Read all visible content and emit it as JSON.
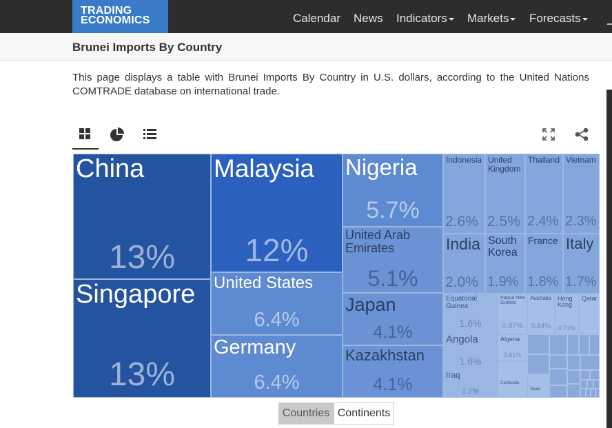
{
  "logo": {
    "line1": "TRADING",
    "line2": "ECONOMICS"
  },
  "nav": [
    {
      "label": "Calendar",
      "dropdown": false
    },
    {
      "label": "News",
      "dropdown": false
    },
    {
      "label": "Indicators",
      "dropdown": true
    },
    {
      "label": "Markets",
      "dropdown": true
    },
    {
      "label": "Forecasts",
      "dropdown": true
    }
  ],
  "page": {
    "title": "Brunei Imports By Country",
    "description": "This page displays a table with Brunei Imports By Country in U.S. dollars, according to the United Nations COMTRADE database on international trade."
  },
  "views": [
    "treemap-icon",
    "pie-chart-icon",
    "list-icon"
  ],
  "tools": [
    "fullscreen-icon",
    "share-icon"
  ],
  "treemap": [
    {
      "name": "China",
      "pct": "13%"
    },
    {
      "name": "Singapore",
      "pct": "13%"
    },
    {
      "name": "Malaysia",
      "pct": "12%"
    },
    {
      "name": "United States",
      "pct": "6.4%"
    },
    {
      "name": "Germany",
      "pct": "6.4%"
    },
    {
      "name": "Nigeria",
      "pct": "5.7%"
    },
    {
      "name": "United Arab Emirates",
      "pct": "5.1%"
    },
    {
      "name": "Japan",
      "pct": "4.1%"
    },
    {
      "name": "Kazakhstan",
      "pct": "4.1%"
    },
    {
      "name": "Indonesia",
      "pct": "2.6%"
    },
    {
      "name": "United Kingdom",
      "pct": "2.5%"
    },
    {
      "name": "Thailand",
      "pct": "2.4%"
    },
    {
      "name": "Vietnam",
      "pct": "2.3%"
    },
    {
      "name": "India",
      "pct": "2.0%"
    },
    {
      "name": "South Korea",
      "pct": "1.9%"
    },
    {
      "name": "France",
      "pct": "1.8%"
    },
    {
      "name": "Italy",
      "pct": "1.7%"
    },
    {
      "name": "Equatorial Guinea",
      "pct": "1.6%"
    },
    {
      "name": "Angola",
      "pct": "1.6%"
    },
    {
      "name": "Iraq",
      "pct": "1.2%"
    },
    {
      "name": "Papua New Guinea",
      "pct": "0.97%"
    },
    {
      "name": "Australia",
      "pct": "0.84%"
    },
    {
      "name": "Hong Kong",
      "pct": "0.71%"
    },
    {
      "name": "Qatar",
      "pct": ""
    },
    {
      "name": "Algeria",
      "pct": "0.61%"
    },
    {
      "name": "Cambodia",
      "pct": ""
    },
    {
      "name": "Spain",
      "pct": ""
    }
  ],
  "toggle": {
    "countries": "Countries",
    "continents": "Continents",
    "active": "countries"
  }
}
